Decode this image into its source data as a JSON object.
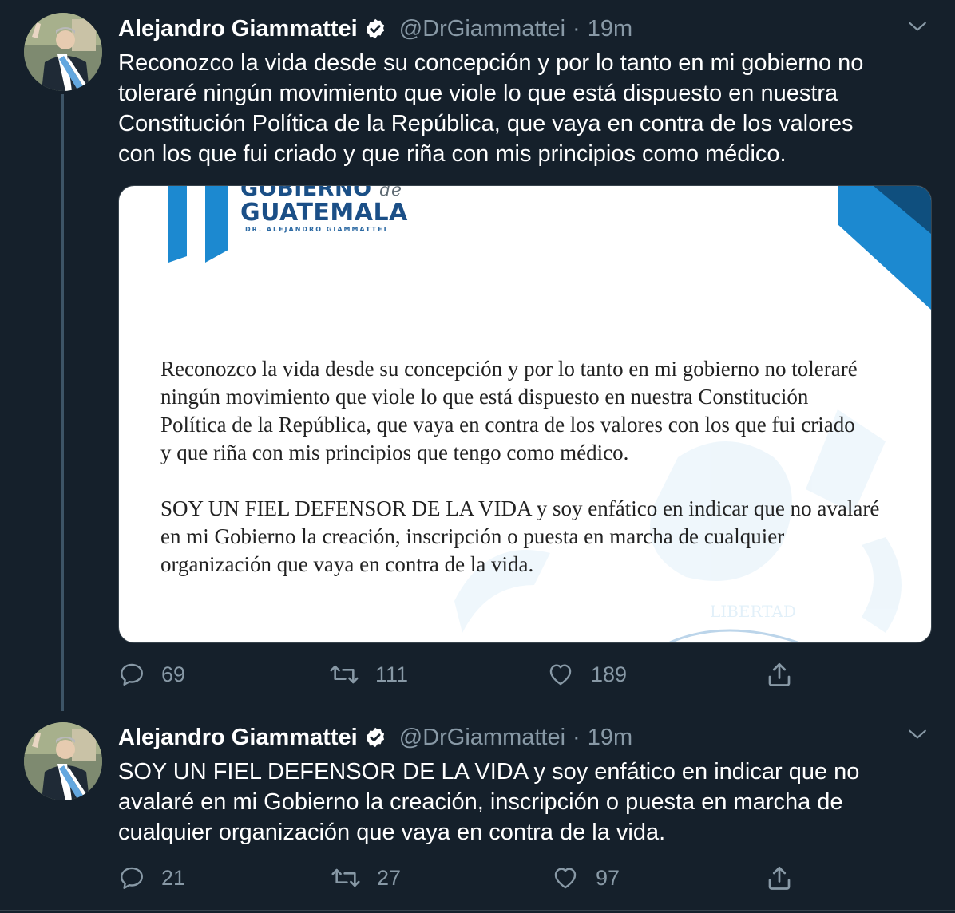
{
  "colors": {
    "background": "#15202b",
    "secondary_text": "#8899a6",
    "border": "#38444d",
    "brand_blue": "#1c89d0"
  },
  "tweets": [
    {
      "author": {
        "name": "Alejandro Giammattei",
        "handle": "@DrGiammattei",
        "verified": true,
        "avatar_icon": "avatar-photo"
      },
      "separator": "·",
      "time": "19m",
      "text_lines": [
        "Reconozco la vida desde su concepción y por lo tanto en mi gobierno no",
        "toleraré ningún movimiento que viole lo que está dispuesto en nuestra",
        "Constitución Política de la República, que vaya en contra de  los valores",
        "con los que fui criado y que riña con mis principios como médico."
      ],
      "media": {
        "letterhead": {
          "line1": "GOBIERNO",
          "line1_suffix": "de",
          "line2": "GUATEMALA",
          "line3": "DR. ALEJANDRO GIAMMATTEI"
        },
        "paragraph1_lines": [
          "Reconozco la vida desde su concepción y por lo tanto en mi gobierno no toleraré",
          "ningún movimiento que viole lo que está dispuesto en nuestra Constitución",
          "Política de la República, que vaya en contra de  los valores con los que fui criado",
          "y que riña con mis principios que tengo como médico."
        ],
        "paragraph2_lines": [
          "SOY UN FIEL DEFENSOR DE LA VIDA y soy enfático en indicar que no avalaré",
          "en mi Gobierno la creación, inscripción o puesta en marcha de cualquier",
          "organización que vaya en contra de la vida."
        ],
        "watermark_text": "LIBERTAD"
      },
      "actions": {
        "replies": "69",
        "retweets": "111",
        "likes": "189"
      }
    },
    {
      "author": {
        "name": "Alejandro Giammattei",
        "handle": "@DrGiammattei",
        "verified": true,
        "avatar_icon": "avatar-photo"
      },
      "separator": "·",
      "time": "19m",
      "text_lines": [
        "SOY UN FIEL DEFENSOR DE LA VIDA y soy enfático en indicar que no",
        "avalaré en mi Gobierno la creación, inscripción o puesta en marcha de",
        "cualquier organización que vaya en contra de la vida."
      ],
      "actions": {
        "replies": "21",
        "retweets": "27",
        "likes": "97"
      }
    }
  ]
}
